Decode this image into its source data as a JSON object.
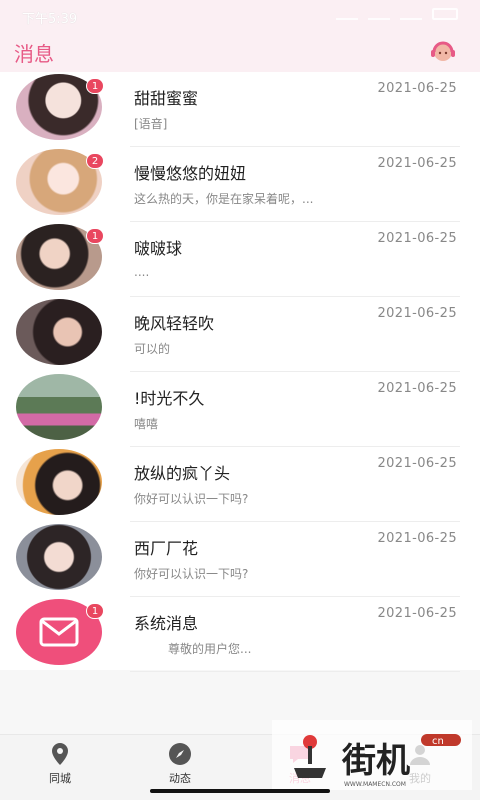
{
  "status": {
    "time": "下午5:39"
  },
  "header": {
    "title": "消息"
  },
  "messages": [
    {
      "name": "甜甜蜜蜜",
      "date": "2021-06-25",
      "preview": "[语音]",
      "badge": "1"
    },
    {
      "name": "慢慢悠悠的妞妞",
      "date": "2021-06-25",
      "preview": "这么热的天，你是在家呆着呢，...",
      "badge": "2"
    },
    {
      "name": "啵啵球",
      "date": "2021-06-25",
      "preview": "....",
      "badge": "1"
    },
    {
      "name": "晚风轻轻吹",
      "date": "2021-06-25",
      "preview": "可以的",
      "badge": ""
    },
    {
      "name": "!时光不久",
      "date": "2021-06-25",
      "preview": "嘻嘻",
      "badge": ""
    },
    {
      "name": "放纵的疯丫头",
      "date": "2021-06-25",
      "preview": "你好可以认识一下吗?",
      "badge": ""
    },
    {
      "name": "西厂厂花",
      "date": "2021-06-25",
      "preview": "你好可以认识一下吗?",
      "badge": ""
    },
    {
      "name": "系统消息",
      "date": "2021-06-25",
      "preview": "尊敬的用户您...",
      "badge": "1"
    }
  ],
  "tabs": [
    {
      "label": "同城",
      "icon": "location-pin-icon"
    },
    {
      "label": "动态",
      "icon": "compass-icon"
    },
    {
      "label": "消息",
      "icon": "chat-icon"
    },
    {
      "label": "我的",
      "icon": "person-icon"
    }
  ],
  "watermark": {
    "text": "街机",
    "badge": "cn",
    "url": "WWW.MAMECN.COM"
  },
  "colors": {
    "accent": "#e75a86",
    "badge": "#e9475f",
    "mail": "#ef4f7b"
  }
}
